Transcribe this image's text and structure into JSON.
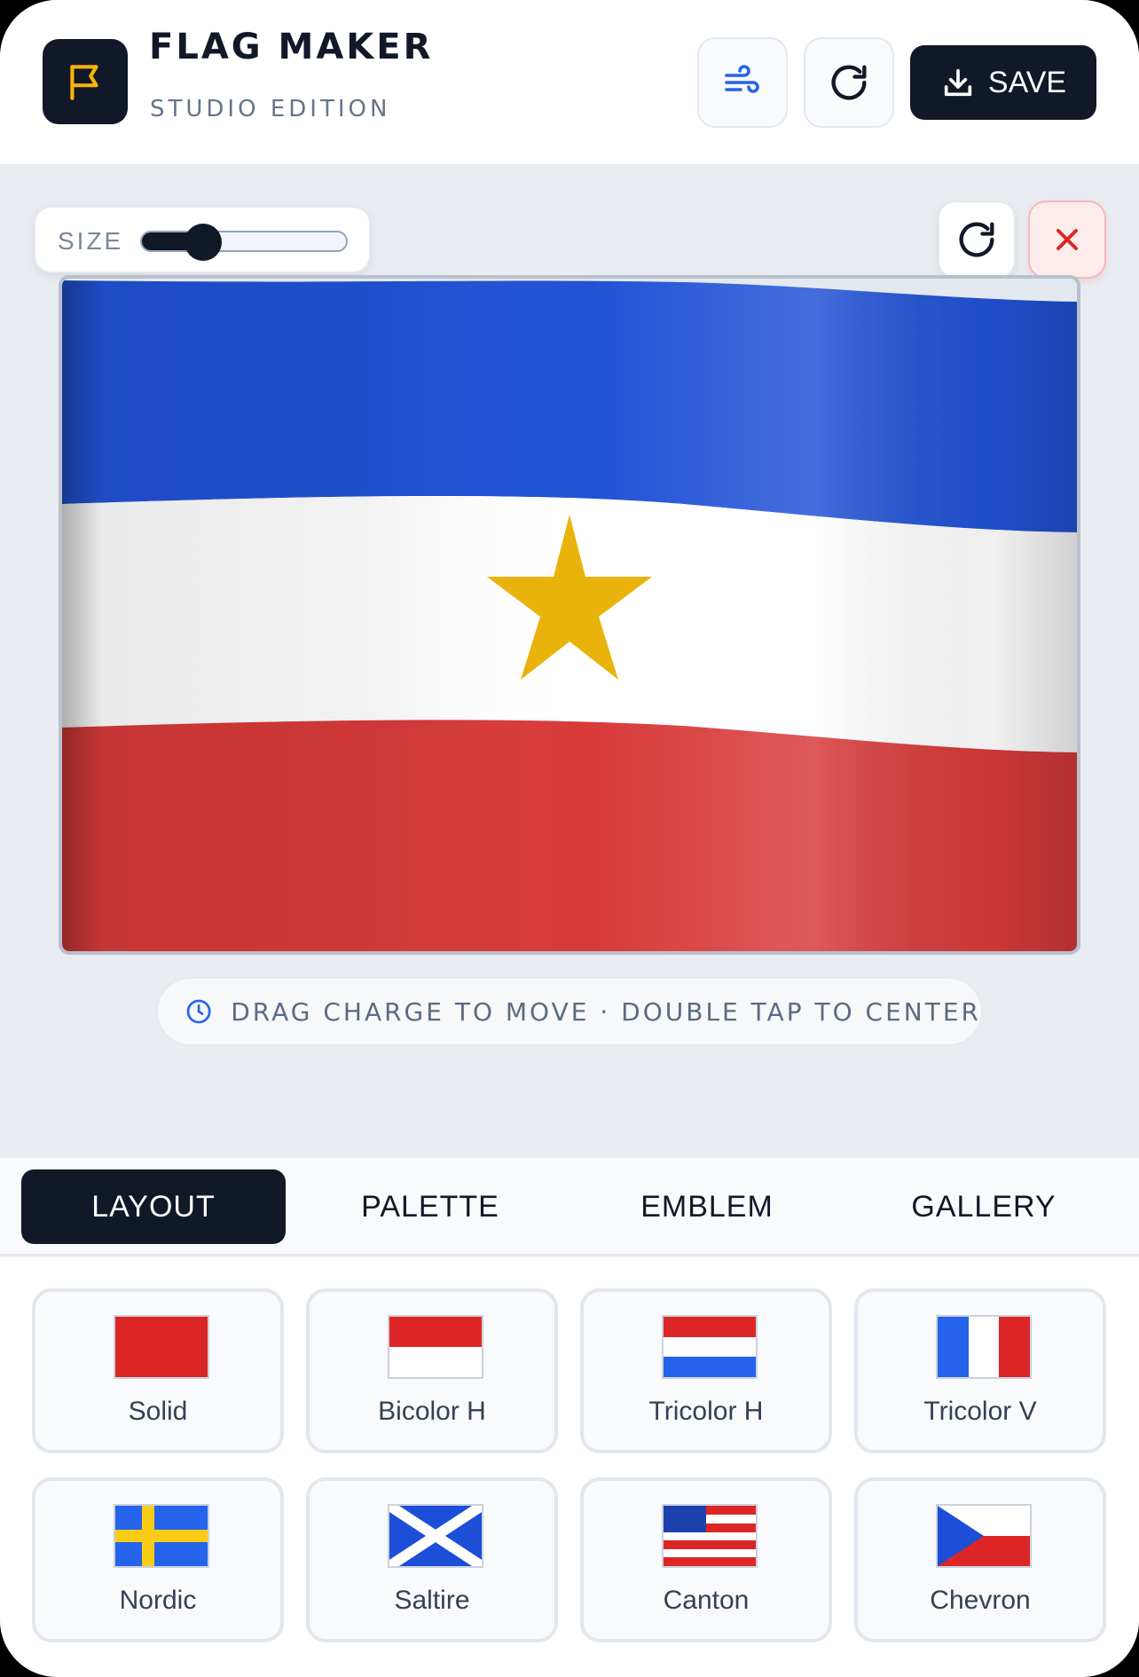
{
  "app": {
    "title": "FLAG MAKER",
    "subtitle": "STUDIO EDITION",
    "save_label": "SAVE"
  },
  "header_actions": [
    {
      "icon": "wind-icon"
    },
    {
      "icon": "refresh-icon"
    },
    {
      "icon": "download-icon"
    }
  ],
  "canvas": {
    "size_label": "SIZE",
    "size_value": 0.3,
    "hint": "DRAG CHARGE TO MOVE · DOUBLE TAP TO CENTER",
    "flag": {
      "stripes": [
        "#2152d6",
        "#ffffff",
        "#d83a3a"
      ],
      "emblem": "star",
      "emblem_color": "#e9b30c"
    }
  },
  "tabs": [
    {
      "label": "LAYOUT",
      "active": true
    },
    {
      "label": "PALETTE",
      "active": false
    },
    {
      "label": "EMBLEM",
      "active": false
    },
    {
      "label": "GALLERY",
      "active": false
    }
  ],
  "layouts": [
    {
      "label": "Solid"
    },
    {
      "label": "Bicolor H"
    },
    {
      "label": "Tricolor H"
    },
    {
      "label": "Tricolor V"
    },
    {
      "label": "Nordic"
    },
    {
      "label": "Saltire"
    },
    {
      "label": "Canton"
    },
    {
      "label": "Chevron"
    }
  ],
  "colors": {
    "dark": "#111827",
    "accent_yellow": "#f5b40b",
    "danger": "#dc2626",
    "blue": "#2563eb"
  }
}
